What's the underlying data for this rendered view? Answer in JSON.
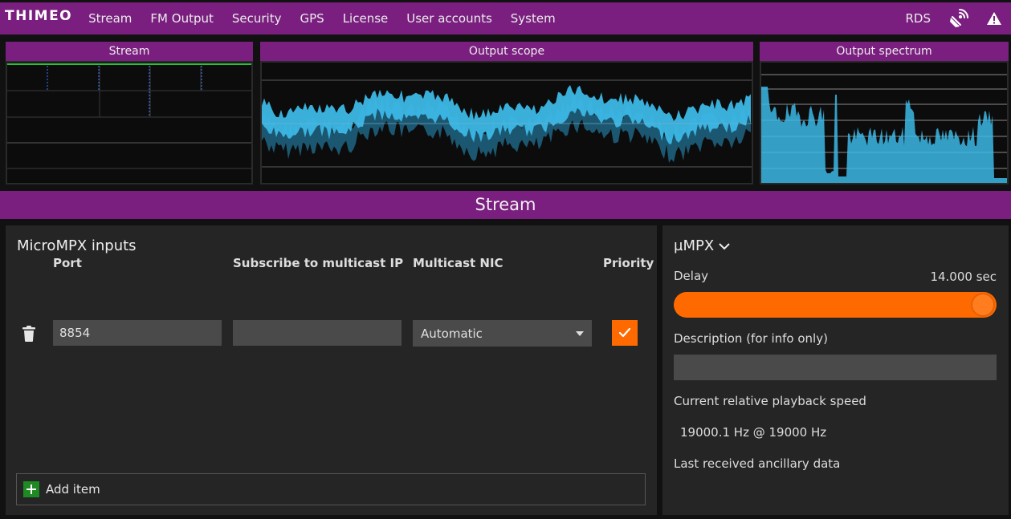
{
  "nav": {
    "logo": "THIMEO",
    "items": [
      "Stream",
      "FM Output",
      "Security",
      "GPS",
      "License",
      "User accounts",
      "System"
    ],
    "rds": "RDS"
  },
  "panels": {
    "stream_title": "Stream",
    "scope_title": "Output scope",
    "spectrum_title": "Output spectrum"
  },
  "section_title": "Stream",
  "inputs": {
    "title": "MicroMPX inputs",
    "headers": {
      "port": "Port",
      "multicast_ip": "Subscribe to multicast IP",
      "nic": "Multicast NIC",
      "priority": "Priority"
    },
    "row": {
      "port": "8854",
      "multicast_ip": "",
      "nic": "Automatic",
      "priority": true
    },
    "add_item": "Add item"
  },
  "mpx": {
    "title": "µMPX",
    "delay_label": "Delay",
    "delay_value": "14.000 sec",
    "delay_fraction": 1.0,
    "description_label": "Description (for info only)",
    "description_value": "",
    "speed_label": "Current relative playback speed",
    "speed_value": "19000.1 Hz @ 19000 Hz",
    "ancillary_label": "Last received ancillary data"
  },
  "colors": {
    "brand": "#7a1f7f",
    "accent": "#ff6a00",
    "add": "#1f8a23",
    "waveform": "#3cb8e6"
  },
  "icons": {
    "broadcast": "satellite-dish-icon",
    "warning": "warning-icon",
    "trash": "trash-icon",
    "check": "check-icon",
    "plus": "plus-icon",
    "chevron": "chevron-down-icon"
  }
}
